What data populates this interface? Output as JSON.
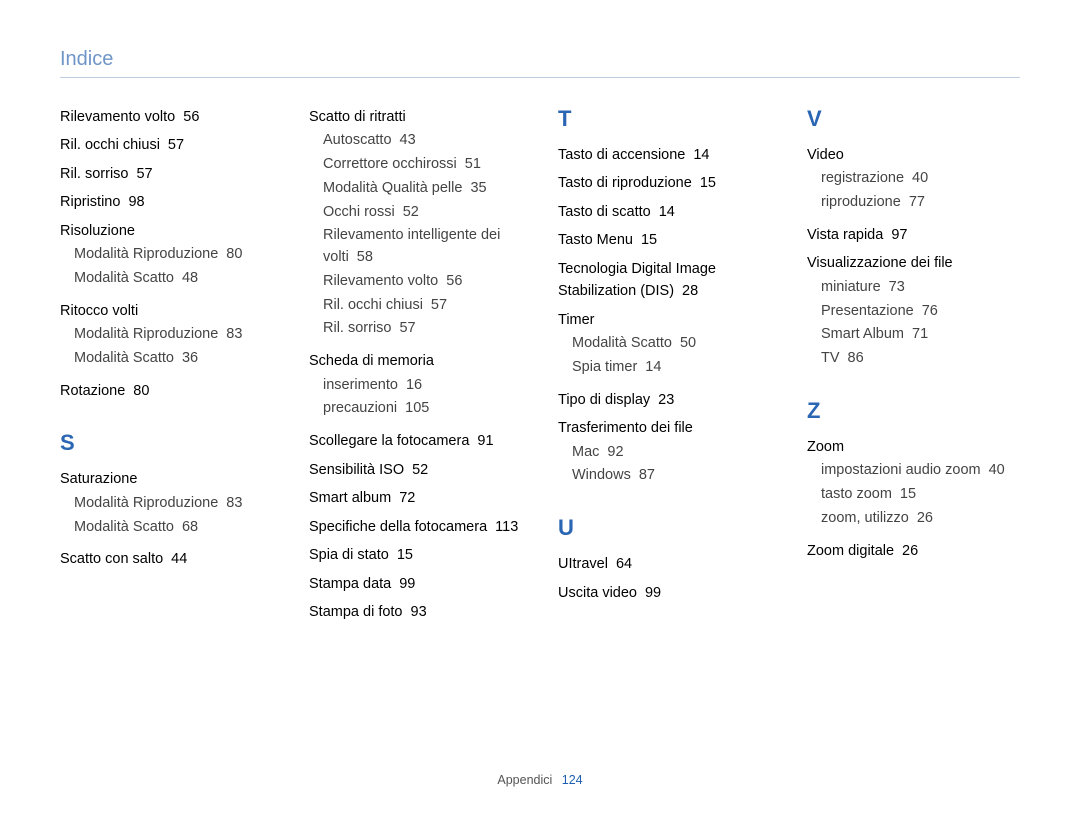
{
  "header": "Indice",
  "footer": {
    "label": "Appendici",
    "page": "124"
  },
  "columns": [
    {
      "blocks": [
        {
          "type": "entry",
          "label": "Rilevamento volto",
          "page": "56"
        },
        {
          "type": "entry",
          "label": "Ril. occhi chiusi",
          "page": "57"
        },
        {
          "type": "entry",
          "label": "Ril. sorriso",
          "page": "57"
        },
        {
          "type": "entry",
          "label": "Ripristino",
          "page": "98"
        },
        {
          "type": "entry",
          "label": "Risoluzione",
          "children": [
            {
              "label": "Modalità Riproduzione",
              "page": "80"
            },
            {
              "label": "Modalità Scatto",
              "page": "48"
            }
          ]
        },
        {
          "type": "entry",
          "label": "Ritocco volti",
          "children": [
            {
              "label": "Modalità Riproduzione",
              "page": "83"
            },
            {
              "label": "Modalità Scatto",
              "page": "36"
            }
          ]
        },
        {
          "type": "entry",
          "label": "Rotazione",
          "page": "80"
        },
        {
          "type": "letter",
          "label": "S"
        },
        {
          "type": "entry",
          "label": "Saturazione",
          "children": [
            {
              "label": "Modalità Riproduzione",
              "page": "83"
            },
            {
              "label": "Modalità Scatto",
              "page": "68"
            }
          ]
        },
        {
          "type": "entry",
          "label": "Scatto con salto",
          "page": "44"
        }
      ]
    },
    {
      "blocks": [
        {
          "type": "entry",
          "label": "Scatto di ritratti",
          "children": [
            {
              "label": "Autoscatto",
              "page": "43"
            },
            {
              "label": "Correttore occhirossi",
              "page": "51"
            },
            {
              "label": "Modalità Qualità pelle",
              "page": "35"
            },
            {
              "label": "Occhi rossi",
              "page": "52"
            },
            {
              "label": "Rilevamento intelligente dei volti",
              "page": "58"
            },
            {
              "label": "Rilevamento volto",
              "page": "56"
            },
            {
              "label": "Ril. occhi chiusi",
              "page": "57"
            },
            {
              "label": "Ril. sorriso",
              "page": "57"
            }
          ]
        },
        {
          "type": "entry",
          "label": "Scheda di memoria",
          "children": [
            {
              "label": "inserimento",
              "page": "16"
            },
            {
              "label": "precauzioni",
              "page": "105"
            }
          ]
        },
        {
          "type": "entry",
          "label": "Scollegare la fotocamera",
          "page": "91"
        },
        {
          "type": "entry",
          "label": "Sensibilità ISO",
          "page": "52"
        },
        {
          "type": "entry",
          "label": "Smart album",
          "page": "72"
        },
        {
          "type": "entry",
          "label": "Specifiche della fotocamera",
          "page": "113"
        },
        {
          "type": "entry",
          "label": "Spia di stato",
          "page": "15"
        },
        {
          "type": "entry",
          "label": "Stampa data",
          "page": "99"
        },
        {
          "type": "entry",
          "label": "Stampa di foto",
          "page": "93"
        }
      ]
    },
    {
      "blocks": [
        {
          "type": "letter",
          "label": "T"
        },
        {
          "type": "entry",
          "label": "Tasto di accensione",
          "page": "14"
        },
        {
          "type": "entry",
          "label": "Tasto di riproduzione",
          "page": "15"
        },
        {
          "type": "entry",
          "label": "Tasto di scatto",
          "page": "14"
        },
        {
          "type": "entry",
          "label": "Tasto Menu",
          "page": "15"
        },
        {
          "type": "entry",
          "label": "Tecnologia Digital Image Stabilization (DIS)",
          "page": "28"
        },
        {
          "type": "entry",
          "label": "Timer",
          "children": [
            {
              "label": "Modalità Scatto",
              "page": "50"
            },
            {
              "label": "Spia timer",
              "page": "14"
            }
          ]
        },
        {
          "type": "entry",
          "label": "Tipo di display",
          "page": "23"
        },
        {
          "type": "entry",
          "label": "Trasferimento dei file",
          "children": [
            {
              "label": "Mac",
              "page": "92"
            },
            {
              "label": "Windows",
              "page": "87"
            }
          ]
        },
        {
          "type": "letter",
          "label": "U"
        },
        {
          "type": "entry",
          "label": "UItravel",
          "page": "64"
        },
        {
          "type": "entry",
          "label": "Uscita video",
          "page": "99"
        }
      ]
    },
    {
      "blocks": [
        {
          "type": "letter",
          "label": "V"
        },
        {
          "type": "entry",
          "label": "Video",
          "children": [
            {
              "label": "registrazione",
              "page": "40"
            },
            {
              "label": "riproduzione",
              "page": "77"
            }
          ]
        },
        {
          "type": "entry",
          "label": "Vista rapida",
          "page": "97"
        },
        {
          "type": "entry",
          "label": "Visualizzazione dei file",
          "children": [
            {
              "label": "miniature",
              "page": "73"
            },
            {
              "label": "Presentazione",
              "page": "76"
            },
            {
              "label": "Smart Album",
              "page": "71"
            },
            {
              "label": "TV",
              "page": "86"
            }
          ]
        },
        {
          "type": "letter",
          "label": "Z"
        },
        {
          "type": "entry",
          "label": "Zoom",
          "children": [
            {
              "label": "impostazioni audio zoom",
              "page": "40"
            },
            {
              "label": "tasto zoom",
              "page": "15"
            },
            {
              "label": "zoom, utilizzo",
              "page": "26"
            }
          ]
        },
        {
          "type": "entry",
          "label": "Zoom digitale",
          "page": "26"
        }
      ]
    }
  ]
}
